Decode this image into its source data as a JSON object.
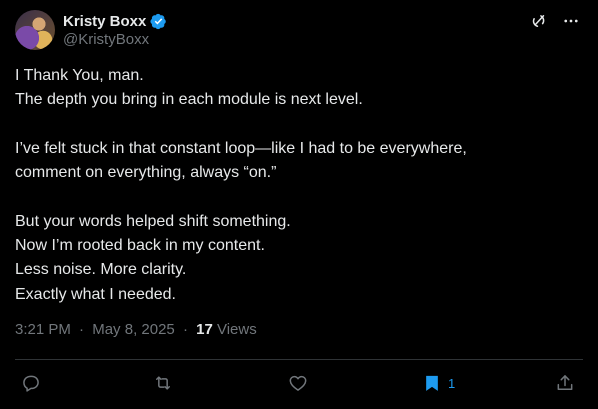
{
  "author": {
    "display_name": "Kristy Boxx",
    "handle": "@KristyBoxx",
    "verified": true
  },
  "body": {
    "lines_block1": [
      "I Thank You, man.",
      "The depth you bring in each module is next level."
    ],
    "lines_block2": [
      "I’ve felt stuck in that constant loop—like I had to be everywhere,",
      "comment on everything, always “on.”"
    ],
    "lines_block3": [
      "But your words helped shift something.",
      "Now I’m rooted back in my content.",
      "Less noise. More clarity.",
      "Exactly what I needed."
    ]
  },
  "meta": {
    "time": "3:21 PM",
    "separator": "·",
    "date": "May 8, 2025",
    "separator2": "·",
    "views_count": "17",
    "views_label": "Views"
  },
  "actions": {
    "bookmark_count": "1"
  },
  "icons": {
    "grok": "grok-icon",
    "more": "more-icon",
    "reply": "reply-icon",
    "retweet": "retweet-icon",
    "like": "like-icon",
    "bookmark": "bookmark-icon",
    "share": "share-icon"
  },
  "colors": {
    "background": "#000000",
    "text": "#e7e9ea",
    "muted": "#71767b",
    "accent": "#1d9bf0"
  }
}
